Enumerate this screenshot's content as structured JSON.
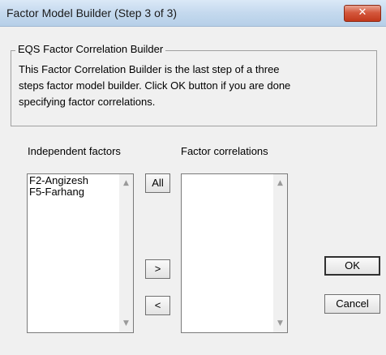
{
  "window": {
    "title": "Factor Model Builder (Step 3 of 3)",
    "close_glyph": "✕"
  },
  "group": {
    "title": "EQS Factor Correlation Builder",
    "lines": [
      "This Factor Correlation Builder is the last step of a three",
      "steps factor model builder.  Click OK button if you are done",
      "specifying factor correlations."
    ]
  },
  "independent": {
    "label": "Independent factors",
    "items": [
      "F2-Angizesh",
      "F5-Farhang"
    ]
  },
  "correlations": {
    "label": "Factor correlations",
    "items": []
  },
  "buttons": {
    "all": "All",
    "add": ">",
    "remove": "<",
    "ok": "OK",
    "cancel": "Cancel"
  },
  "icons": {
    "scroll_up": "scroll-up-arrow-icon",
    "scroll_down": "scroll-down-arrow-icon"
  },
  "colors": {
    "close_button": "#c2381b",
    "titlebar": "#c4d9ee"
  }
}
